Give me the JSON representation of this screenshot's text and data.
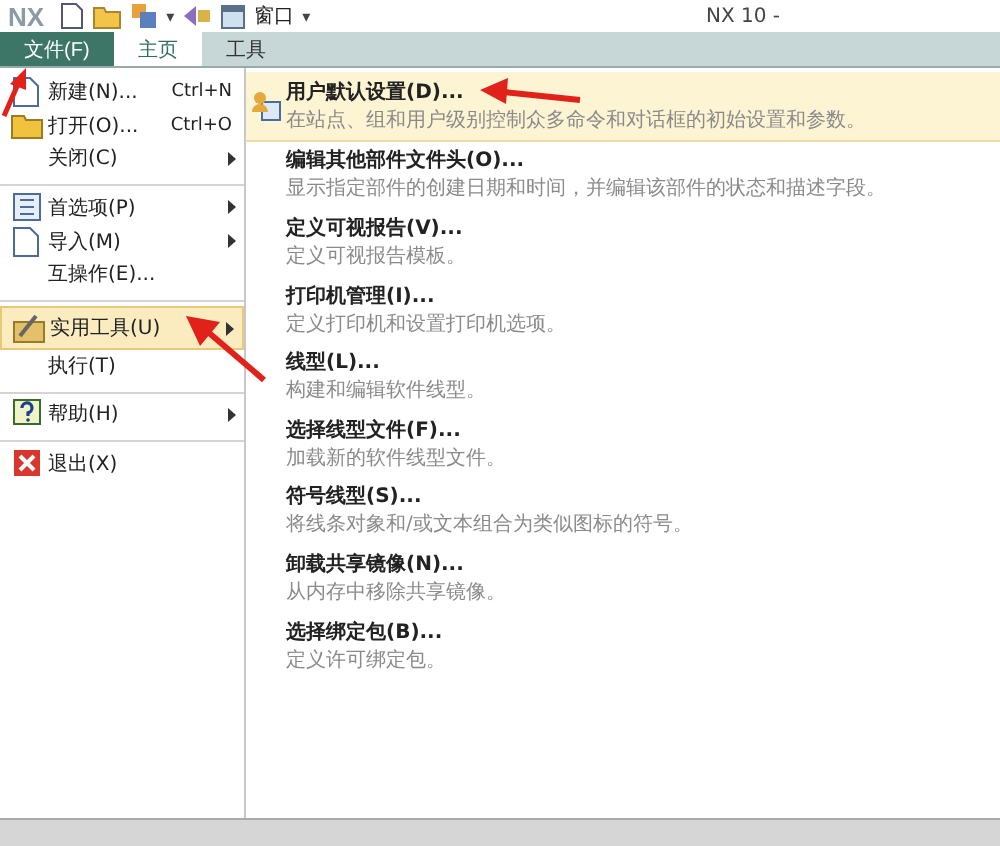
{
  "title_bar": {
    "logo": "NX",
    "parts_caret": "▾",
    "window_menu": "窗口",
    "window_caret": "▾",
    "title": "NX 10 -"
  },
  "tabs": [
    {
      "label": "文件(F)",
      "kind": "file",
      "selected": false
    },
    {
      "label": "主页",
      "kind": "tab",
      "selected": true
    },
    {
      "label": "工具",
      "kind": "tab",
      "selected": false
    }
  ],
  "file_menu": [
    {
      "label": "新建(N)...",
      "shortcut": "Ctrl+N",
      "submenu": false,
      "selected": false,
      "separator_after": false
    },
    {
      "label": "打开(O)...",
      "shortcut": "Ctrl+O",
      "submenu": false,
      "selected": false,
      "separator_after": false
    },
    {
      "label": "关闭(C)",
      "submenu": true,
      "selected": false,
      "separator_after": true
    },
    {
      "label": "首选项(P)",
      "submenu": true,
      "selected": false,
      "separator_after": false
    },
    {
      "label": "导入(M)",
      "submenu": true,
      "selected": false,
      "separator_after": false
    },
    {
      "label": "互操作(E)...",
      "submenu": false,
      "selected": false,
      "separator_after": true
    },
    {
      "label": "实用工具(U)",
      "submenu": true,
      "selected": true,
      "separator_after": false
    },
    {
      "label": "执行(T)",
      "submenu": false,
      "selected": false,
      "separator_after": true
    },
    {
      "label": "帮助(H)",
      "submenu": true,
      "selected": false,
      "separator_after": true
    },
    {
      "label": "退出(X)",
      "submenu": false,
      "selected": false,
      "separator_after": false
    }
  ],
  "submenu": [
    {
      "title": "用户默认设置(D)...",
      "description": "在站点、组和用户级别控制众多命令和对话框的初始设置和参数。",
      "selected": true
    },
    {
      "title": "编辑其他部件文件头(O)...",
      "description": "显示指定部件的创建日期和时间，并编辑该部件的状态和描述字段。",
      "selected": false
    },
    {
      "title": "定义可视报告(V)...",
      "description": "定义可视报告模板。",
      "selected": false
    },
    {
      "title": "打印机管理(I)...",
      "description": "定义打印机和设置打印机选项。",
      "selected": false
    },
    {
      "title": "线型(L)...",
      "description": "构建和编辑软件线型。",
      "selected": false
    },
    {
      "title": "选择线型文件(F)...",
      "description": "加载新的软件线型文件。",
      "selected": false
    },
    {
      "title": "符号线型(S)...",
      "description": "将线条对象和/或文本组合为类似图标的符号。",
      "selected": false
    },
    {
      "title": "卸载共享镜像(N)...",
      "description": "从内存中移除共享镜像。",
      "selected": false
    },
    {
      "title": "选择绑定包(B)...",
      "description": "定义许可绑定包。",
      "selected": false
    }
  ]
}
